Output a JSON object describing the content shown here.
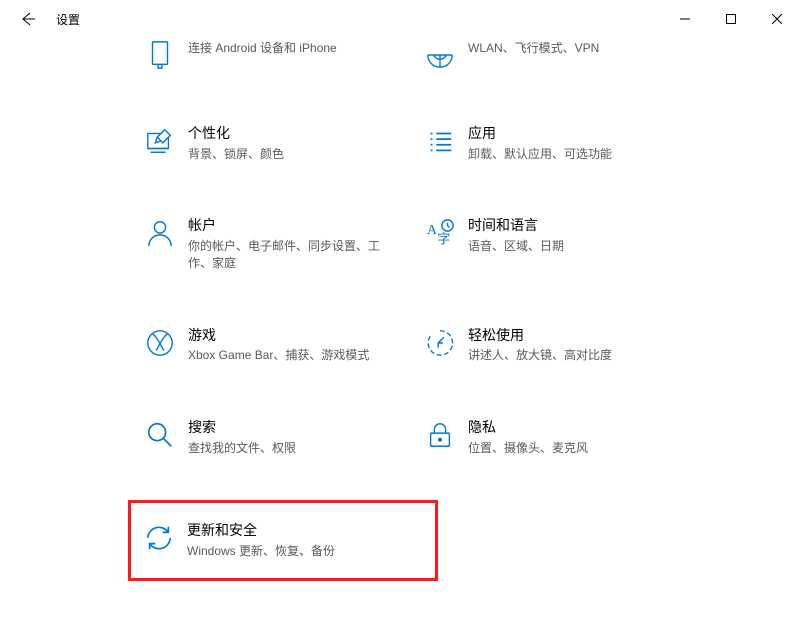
{
  "window": {
    "title": "设置"
  },
  "tiles": [
    {
      "title": "",
      "desc": "连接 Android 设备和 iPhone"
    },
    {
      "title": "",
      "desc": "WLAN、飞行模式、VPN"
    },
    {
      "title": "个性化",
      "desc": "背景、锁屏、颜色"
    },
    {
      "title": "应用",
      "desc": "卸载、默认应用、可选功能"
    },
    {
      "title": "帐户",
      "desc": "你的帐户、电子邮件、同步设置、工作、家庭"
    },
    {
      "title": "时间和语言",
      "desc": "语音、区域、日期"
    },
    {
      "title": "游戏",
      "desc": "Xbox Game Bar、捕获、游戏模式"
    },
    {
      "title": "轻松使用",
      "desc": "讲述人、放大镜、高对比度"
    },
    {
      "title": "搜索",
      "desc": "查找我的文件、权限"
    },
    {
      "title": "隐私",
      "desc": "位置、摄像头、麦克风"
    },
    {
      "title": "更新和安全",
      "desc": "Windows 更新、恢复、备份"
    }
  ]
}
